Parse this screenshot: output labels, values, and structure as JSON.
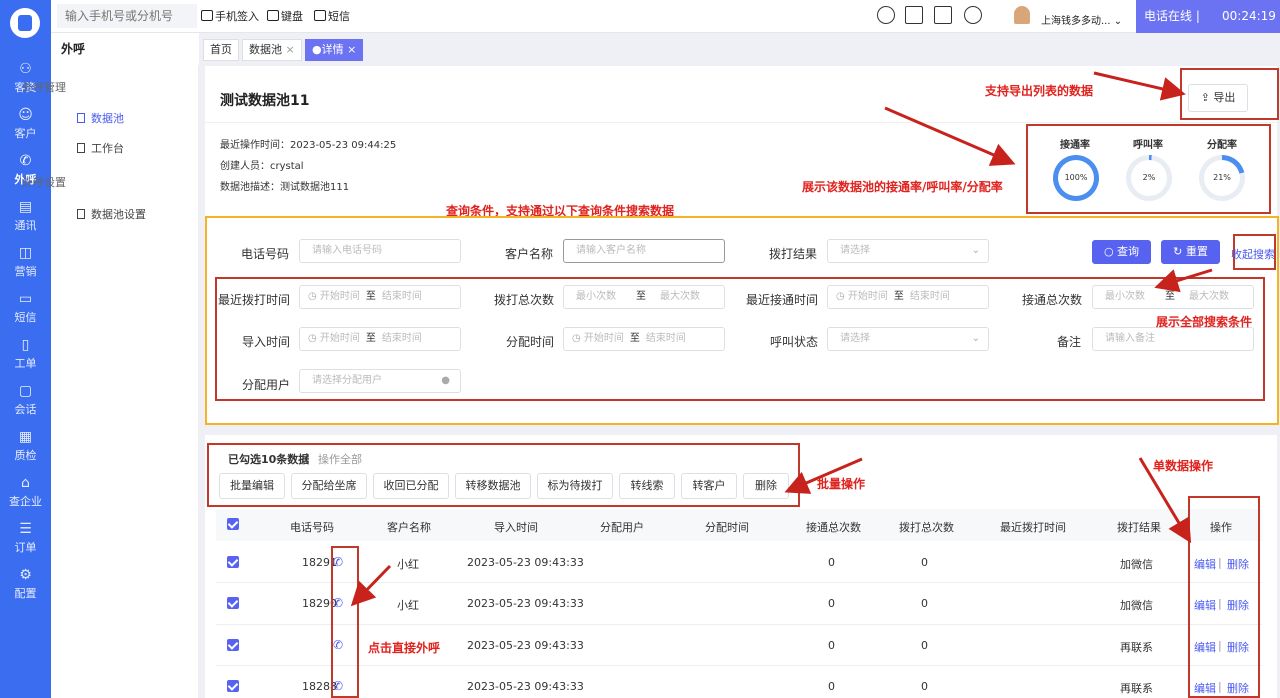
{
  "topbar": {
    "search_placeholder": "输入手机号或分机号",
    "tools": [
      "手机签入",
      "键盘",
      "短信"
    ],
    "company": "上海钱多多动...",
    "status_label": "电话在线 |",
    "timer": "00:24:19"
  },
  "rail": {
    "items": [
      "客资",
      "客户",
      "外呼",
      "通讯",
      "营销",
      "短信",
      "工单",
      "会话",
      "质检",
      "查企业",
      "订单",
      "配置"
    ],
    "active": "外呼"
  },
  "section_title": "外呼",
  "tabs": [
    "首页",
    "数据池",
    "详情"
  ],
  "subnav": {
    "group1": "外呼管理",
    "item1": "数据池",
    "item2": "工作台",
    "group2": "外呼设置",
    "item3": "数据池设置"
  },
  "pool": {
    "title": "测试数据池11",
    "export_label": "导出",
    "last_op": "最近操作时间：2023-05-23 09:44:25",
    "creator": "创建人员：crystal",
    "desc": "数据池描述：测试数据池111",
    "rates": [
      {
        "label": "接通率",
        "value": "100%",
        "pct": 100
      },
      {
        "label": "呼叫率",
        "value": "2%",
        "pct": 2
      },
      {
        "label": "分配率",
        "value": "21%",
        "pct": 21
      }
    ]
  },
  "filters": {
    "phone_label": "电话号码",
    "phone_ph": "请输入电话号码",
    "name_label": "客户名称",
    "name_ph": "请输入客户名称",
    "result_label": "拨打结果",
    "select_ph": "请选择",
    "query_btn": "查询",
    "reset_btn": "重置",
    "collapse": "收起搜索",
    "last_call_label": "最近拨打时间",
    "start_ph": "开始时间",
    "to": "至",
    "end_ph": "结束时间",
    "total_calls_label": "拨打总次数",
    "min_ph": "最小次数",
    "max_ph": "最大次数",
    "last_connect_label": "最近接通时间",
    "total_connect_label": "接通总次数",
    "import_time_label": "导入时间",
    "assign_time_label": "分配时间",
    "call_status_label": "呼叫状态",
    "remark_label": "备注",
    "remark_ph": "请输入备注",
    "assign_user_label": "分配用户",
    "assign_user_ph": "请选择分配用户"
  },
  "batch": {
    "selected": "已勾选10条数据",
    "separator": "|",
    "op_all": "操作全部",
    "buttons": [
      "批量编辑",
      "分配给坐席",
      "收回已分配",
      "转移数据池",
      "标为待拨打",
      "转线索",
      "转客户",
      "删除"
    ]
  },
  "table": {
    "headers": [
      "电话号码",
      "客户名称",
      "导入时间",
      "分配用户",
      "分配时间",
      "接通总次数",
      "拨打总次数",
      "最近拨打时间",
      "拨打结果",
      "操作"
    ],
    "rows": [
      {
        "phone": "18291",
        "name": "小红",
        "import_time": "2023-05-23 09:43:33",
        "connect": "0",
        "calls": "0",
        "result": "加微信"
      },
      {
        "phone": "18290",
        "name": "小红",
        "import_time": "2023-05-23 09:43:33",
        "connect": "0",
        "calls": "0",
        "result": "加微信"
      },
      {
        "phone": "",
        "name": "",
        "import_time": "2023-05-23 09:43:33",
        "connect": "0",
        "calls": "0",
        "result": "再联系"
      },
      {
        "phone": "18288",
        "name": "",
        "import_time": "2023-05-23 09:43:33",
        "connect": "0",
        "calls": "0",
        "result": "再联系"
      }
    ],
    "edit": "编辑",
    "divider": "|",
    "delete": "删除"
  },
  "annotations": {
    "export": "支持导出列表的数据",
    "rates": "展示该数据池的接通率/呼叫率/分配率",
    "query": "查询条件，支持通过以下查询条件搜索数据",
    "expand": "展示全部搜索条件",
    "batch": "批量操作",
    "single": "单数据操作",
    "call": "点击直接外呼"
  },
  "colors": {
    "accent": "#5763f0",
    "rail": "#3b6df1",
    "annotation": "#e0231e",
    "query_box": "#f5b323"
  }
}
